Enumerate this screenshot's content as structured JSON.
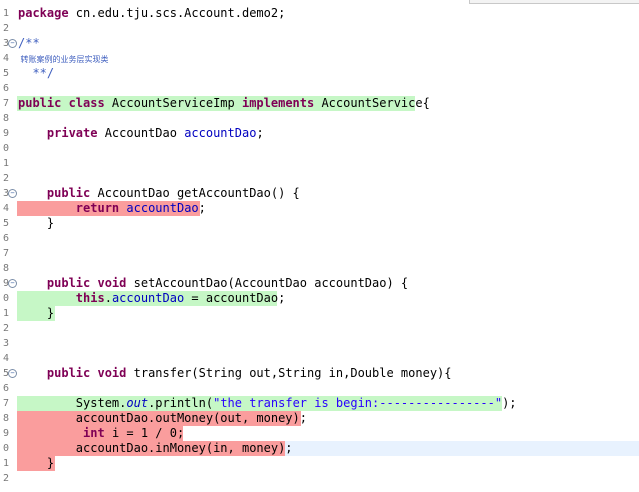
{
  "colors": {
    "added": "#c6f7c6",
    "removed": "#fa9d9d",
    "current_line": "#e8f2fe",
    "keyword": "#7f0055",
    "field": "#0000c0",
    "string": "#2a00ff",
    "comment": "#3f5fbf"
  },
  "lines": [
    {
      "n": "1",
      "tokens": [
        {
          "t": "package",
          "c": "kw"
        },
        {
          "t": " cn.edu.tju.scs.Account.demo2;"
        }
      ]
    },
    {
      "n": "2",
      "tokens": []
    },
    {
      "n": "3",
      "fold": "⊖",
      "tokens": [
        {
          "t": "/**",
          "c": "cmt"
        }
      ]
    },
    {
      "n": "4",
      "tokens": [
        {
          "t": " 转账案例的业务层实现类",
          "c": "cmt cjk"
        }
      ]
    },
    {
      "n": "5",
      "tokens": [
        {
          "t": "  **/",
          "c": "cmt"
        }
      ]
    },
    {
      "n": "6",
      "tokens": []
    },
    {
      "n": "7",
      "hl": "added",
      "tokens": [
        {
          "t": "public class",
          "c": "kw"
        },
        {
          "t": " AccountServiceImp "
        },
        {
          "t": "implements",
          "c": "kw"
        },
        {
          "t": " AccountService{"
        }
      ]
    },
    {
      "n": "8",
      "tokens": []
    },
    {
      "n": "9",
      "tokens": [
        {
          "t": "    "
        },
        {
          "t": "private",
          "c": "kw"
        },
        {
          "t": " AccountDao "
        },
        {
          "t": "accountDao",
          "c": "fld"
        },
        {
          "t": ";"
        }
      ]
    },
    {
      "n": "0",
      "tokens": []
    },
    {
      "n": "1",
      "tokens": []
    },
    {
      "n": "2",
      "tokens": []
    },
    {
      "n": "3",
      "fold": "⊖",
      "tokens": [
        {
          "t": "    "
        },
        {
          "t": "public",
          "c": "kw"
        },
        {
          "t": " AccountDao getAccountDao() {"
        }
      ]
    },
    {
      "n": "4",
      "hl": "removed",
      "tokens": [
        {
          "t": "        "
        },
        {
          "t": "return",
          "c": "kw"
        },
        {
          "t": " "
        },
        {
          "t": "accountDao",
          "c": "fld"
        },
        {
          "t": ";"
        }
      ]
    },
    {
      "n": "5",
      "tokens": [
        {
          "t": "    }"
        }
      ]
    },
    {
      "n": "6",
      "tokens": []
    },
    {
      "n": "7",
      "tokens": []
    },
    {
      "n": "8",
      "tokens": []
    },
    {
      "n": "9",
      "fold": "⊖",
      "tokens": [
        {
          "t": "    "
        },
        {
          "t": "public void",
          "c": "kw"
        },
        {
          "t": " setAccountDao(AccountDao accountDao) {"
        }
      ]
    },
    {
      "n": "0",
      "hl": "added",
      "tokens": [
        {
          "t": "        "
        },
        {
          "t": "this",
          "c": "kw"
        },
        {
          "t": "."
        },
        {
          "t": "accountDao",
          "c": "fld"
        },
        {
          "t": " = accountDao;"
        }
      ]
    },
    {
      "n": "1",
      "hl": "added",
      "tokens": [
        {
          "t": "    }"
        }
      ]
    },
    {
      "n": "2",
      "tokens": []
    },
    {
      "n": "3",
      "tokens": []
    },
    {
      "n": "4",
      "tokens": []
    },
    {
      "n": "5",
      "fold": "⊖",
      "tokens": [
        {
          "t": "    "
        },
        {
          "t": "public void",
          "c": "kw"
        },
        {
          "t": " transfer(String out,String in,Double money){"
        }
      ]
    },
    {
      "n": "6",
      "tokens": []
    },
    {
      "n": "7",
      "hl": "added",
      "tokens": [
        {
          "t": "        System."
        },
        {
          "t": "out",
          "c": "st"
        },
        {
          "t": ".println("
        },
        {
          "t": "\"the transfer is begin:----------------\"",
          "c": "str"
        },
        {
          "t": ");"
        }
      ]
    },
    {
      "n": "8",
      "hl": "removed",
      "tokens": [
        {
          "t": "        accountDao.outMoney(out, money);"
        }
      ]
    },
    {
      "n": "9",
      "hl": "removed",
      "tokens": [
        {
          "t": "         "
        },
        {
          "t": "int",
          "c": "kw"
        },
        {
          "t": " i = 1 / 0;"
        }
      ]
    },
    {
      "n": "0",
      "hl": "removed",
      "cur": true,
      "tokens": [
        {
          "t": "        accountDao.inMoney(in, money);"
        }
      ]
    },
    {
      "n": "1",
      "hl": "removed",
      "tokens": [
        {
          "t": "    }"
        }
      ]
    },
    {
      "n": "2",
      "tokens": []
    }
  ]
}
